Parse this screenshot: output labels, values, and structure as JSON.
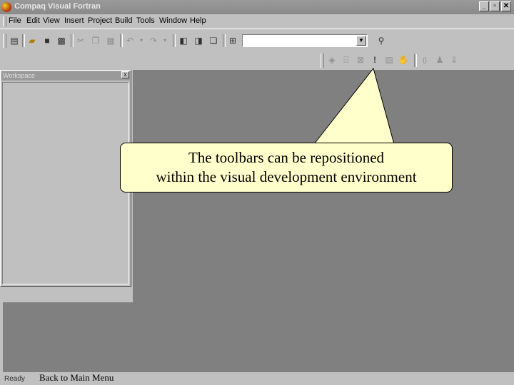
{
  "window": {
    "title": "Compaq Visual Fortran",
    "min": "_",
    "max": "▫",
    "close": "✕"
  },
  "menu": [
    "File",
    "Edit",
    "View",
    "Insert",
    "Project",
    "Build",
    "Tools",
    "Window",
    "Help"
  ],
  "toolbar": {
    "icons": [
      "new-icon",
      "open-icon",
      "save-icon",
      "save-all-icon",
      "cut-icon",
      "copy-icon",
      "paste-icon",
      "undo-icon",
      "redo-icon",
      "workspace-icon",
      "output-icon",
      "windows-icon",
      "find-in-files-icon",
      "find-icon"
    ],
    "combo_value": ""
  },
  "build_toolbar": {
    "icons": [
      "compile-icon",
      "build-icon",
      "stop-build-icon",
      "execute-icon",
      "go-icon",
      "breakpoint-icon",
      "disasm-icon",
      "step-into-icon",
      "run-to-cursor-icon"
    ]
  },
  "workspace": {
    "title": "Workspace",
    "close": "x"
  },
  "callout": {
    "line1": "The toolbars can be repositioned",
    "line2": "within the visual development environment"
  },
  "status": {
    "text": "Ready"
  },
  "link": {
    "back": "Back to Main Menu"
  }
}
